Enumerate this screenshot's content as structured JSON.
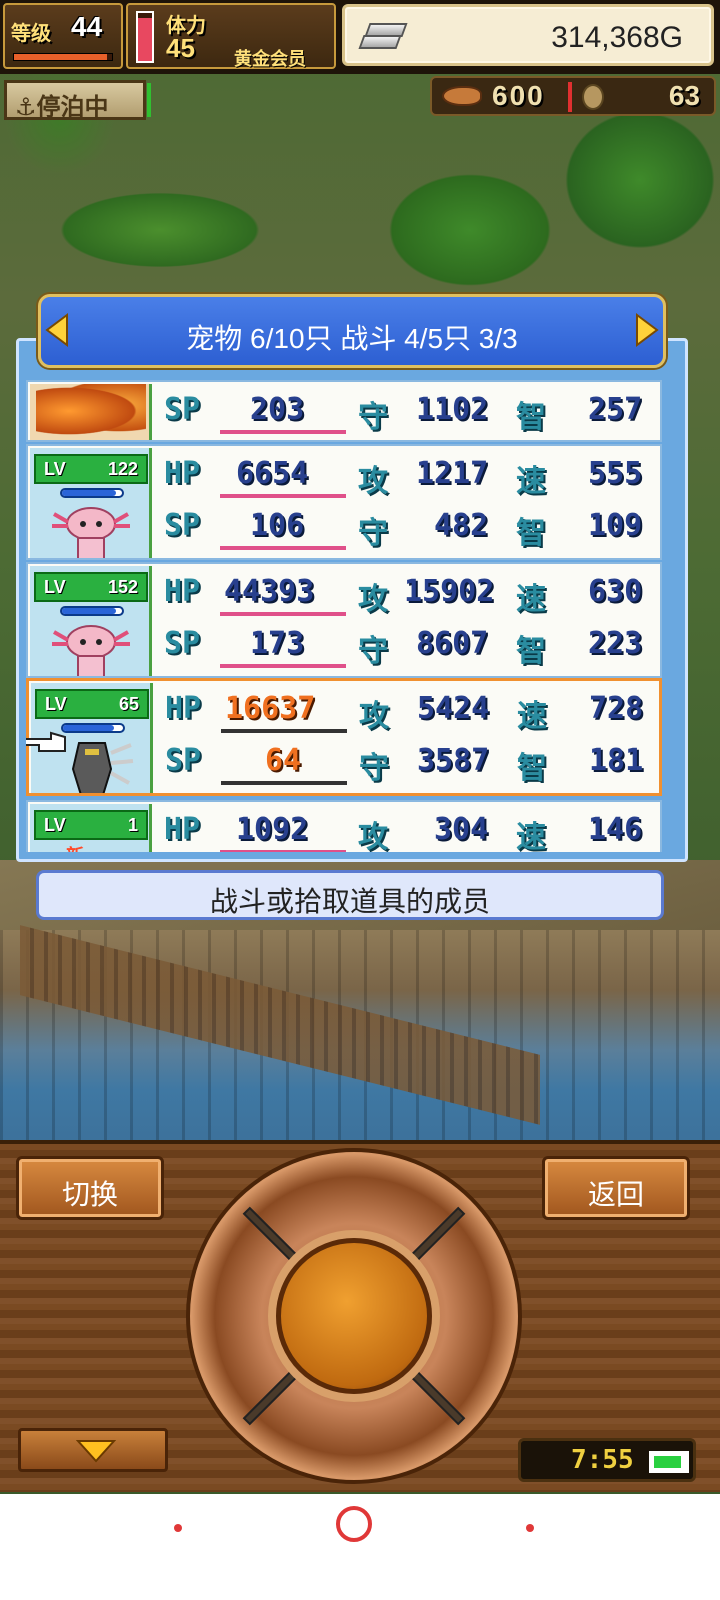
{
  "hud": {
    "level_label": "等级",
    "level": "44",
    "level_progress": 0.95,
    "stamina_label": "体力",
    "stamina": "45",
    "stamina_gauge": 0.9,
    "membership": "黄金会员",
    "gold": "314,368G",
    "moor_status": "停泊中",
    "fish": "600",
    "coins": "63"
  },
  "panel": {
    "title": "宠物 6/10只 战斗 4/5只  3/3",
    "message": "战斗或拾取道具的成员",
    "labels": {
      "hp": "HP",
      "sp": "SP",
      "atk": "攻",
      "def": "守",
      "spd": "速",
      "int": "智"
    },
    "rows": [
      {
        "sp": "203",
        "def": "1102",
        "int": "257"
      },
      {
        "lv_label": "LV",
        "lv": "122",
        "hp": "6654",
        "atk": "1217",
        "spd": "555",
        "sp": "106",
        "def": "482",
        "int": "109",
        "hp_fill": 0.9
      },
      {
        "lv_label": "LV",
        "lv": "152",
        "hp": "44393",
        "atk": "15902",
        "spd": "630",
        "sp": "173",
        "def": "8607",
        "int": "223",
        "hp_fill": 0.9
      },
      {
        "lv_label": "LV",
        "lv": "65",
        "hp": "16637",
        "atk": "5424",
        "spd": "728",
        "sp": "64",
        "def": "3587",
        "int": "181",
        "hp_fill": 0.85
      },
      {
        "lv_label": "LV",
        "lv": "1",
        "hp": "1092",
        "atk": "304",
        "spd": "146",
        "new": "新"
      }
    ]
  },
  "controls": {
    "switch_label": "切换",
    "back_label": "返回",
    "clock": "7:55",
    "battery": 0.8
  },
  "colors": {
    "accent": "#2d5fd2",
    "selected_border": "#f09030",
    "stat_value": "#28408e",
    "stat_key": "#2a8ca0"
  }
}
